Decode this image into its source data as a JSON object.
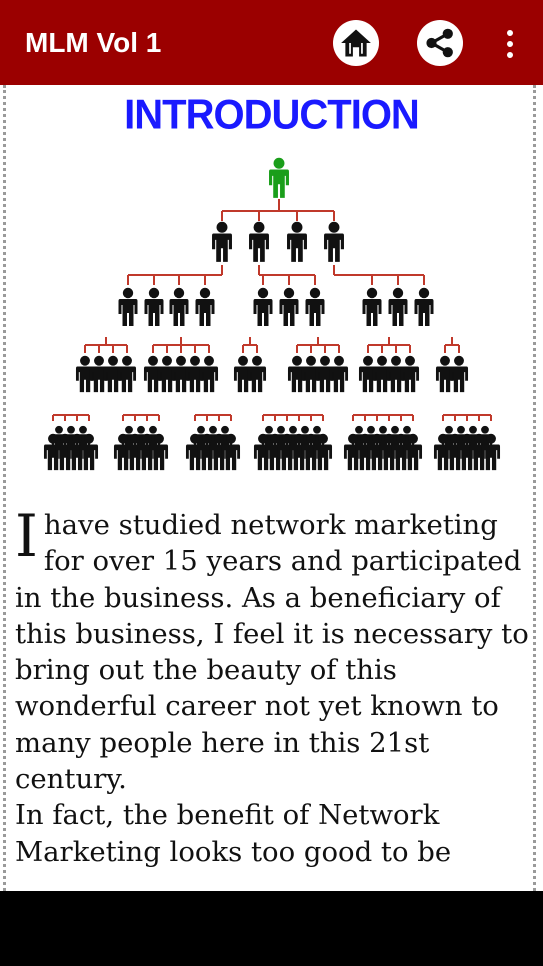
{
  "appbar": {
    "title": "MLM Vol 1",
    "background": "#9b0000",
    "icons": [
      "home-icon",
      "share-icon",
      "more-vert-icon"
    ]
  },
  "article": {
    "heading": "INTRODUCTION",
    "heading_color": "#1a1aff",
    "dropcap": "I",
    "paragraph1": " have studied network marketing for over 15 years and participated in the business. As a beneficiary of this business, I feel it is necessary to bring out the beauty of this wonderful career not yet known to many people here in this 21st century.",
    "paragraph2": "In fact, the benefit of Network Marketing looks too good to be",
    "image": "mlm-pyramid-diagram",
    "top_person_color": "#1a9e1a",
    "connector_color": "#c0392b"
  }
}
